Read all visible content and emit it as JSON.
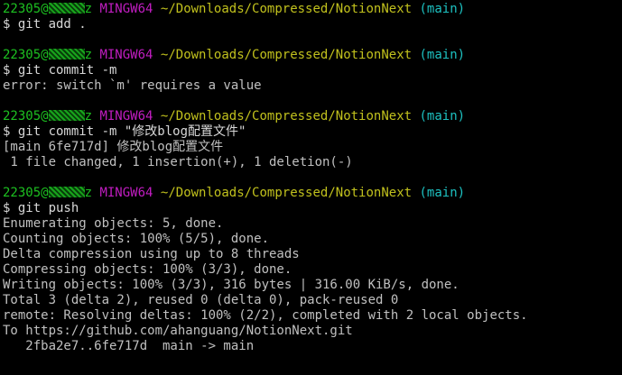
{
  "prompt": {
    "user": "22305@",
    "user_suffix": "z",
    "host": "MINGW64",
    "path": "~/Downloads/Compressed/NotionNext",
    "branch": "(main)"
  },
  "blocks": [
    {
      "command": "$ git add .",
      "output": []
    },
    {
      "command": "$ git commit -m",
      "output": [
        "error: switch `m' requires a value"
      ]
    },
    {
      "command": "$ git commit -m \"修改blog配置文件\"",
      "output": [
        "[main 6fe717d] 修改blog配置文件",
        " 1 file changed, 1 insertion(+), 1 deletion(-)"
      ]
    },
    {
      "command": "$ git push",
      "output": [
        "Enumerating objects: 5, done.",
        "Counting objects: 100% (5/5), done.",
        "Delta compression using up to 8 threads",
        "Compressing objects: 100% (3/3), done.",
        "Writing objects: 100% (3/3), 316 bytes | 316.00 KiB/s, done.",
        "Total 3 (delta 2), reused 0 (delta 0), pack-reused 0",
        "remote: Resolving deltas: 100% (2/2), completed with 2 local objects.",
        "To https://github.com/ahanguang/NotionNext.git",
        "   2fba2e7..6fe717d  main -> main"
      ]
    }
  ],
  "colors": {
    "background": "#000000",
    "user": "#1dc121",
    "host": "#c11dc1",
    "path": "#c1c11d",
    "branch": "#1dc1c1",
    "text": "#c0c0c0"
  }
}
